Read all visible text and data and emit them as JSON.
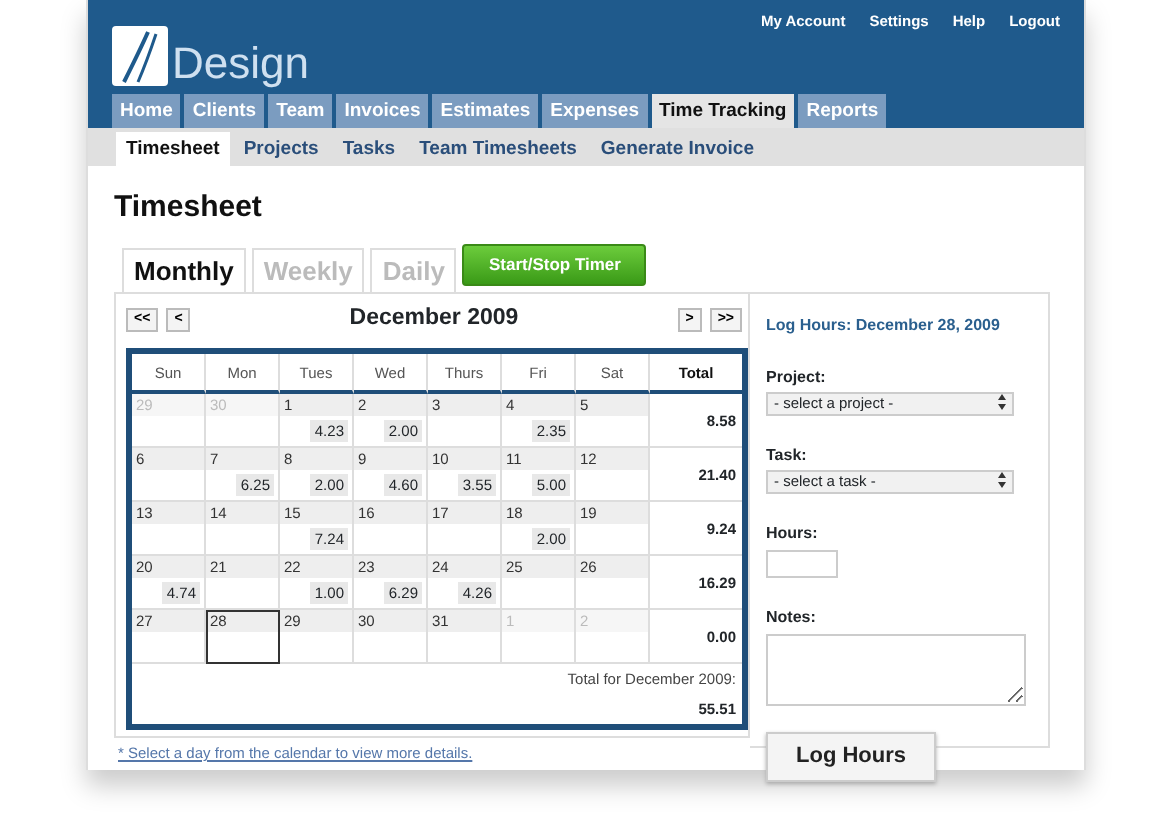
{
  "header": {
    "logo_text": "Design",
    "top_links": [
      "My Account",
      "Settings",
      "Help",
      "Logout"
    ]
  },
  "nav": [
    {
      "label": "Home",
      "selected": false
    },
    {
      "label": "Clients",
      "selected": false
    },
    {
      "label": "Team",
      "selected": false
    },
    {
      "label": "Invoices",
      "selected": false
    },
    {
      "label": "Estimates",
      "selected": false
    },
    {
      "label": "Expenses",
      "selected": false
    },
    {
      "label": "Time Tracking",
      "selected": true
    },
    {
      "label": "Reports",
      "selected": false
    }
  ],
  "subnav": [
    {
      "label": "Timesheet",
      "selected": true
    },
    {
      "label": "Projects",
      "selected": false
    },
    {
      "label": "Tasks",
      "selected": false
    },
    {
      "label": "Team Timesheets",
      "selected": false
    },
    {
      "label": "Generate Invoice",
      "selected": false
    }
  ],
  "page_title": "Timesheet",
  "view_tabs": [
    {
      "label": "Monthly",
      "selected": true
    },
    {
      "label": "Weekly",
      "selected": false
    },
    {
      "label": "Daily",
      "selected": false
    }
  ],
  "timer_button": "Start/Stop Timer",
  "calendar": {
    "prev_buttons": [
      "<<",
      "<"
    ],
    "month": "December 2009",
    "next_buttons": [
      ">",
      ">>"
    ],
    "weekdays": [
      "Sun",
      "Mon",
      "Tues",
      "Wed",
      "Thurs",
      "Fri",
      "Sat"
    ],
    "total_heading": "Total",
    "weeks": [
      {
        "days": [
          {
            "day": "29",
            "muted": true,
            "selected": false
          },
          {
            "day": "30",
            "muted": true,
            "selected": false
          },
          {
            "day": "1",
            "muted": false,
            "selected": false,
            "hours": "4.23"
          },
          {
            "day": "2",
            "muted": false,
            "selected": false,
            "hours": "2.00"
          },
          {
            "day": "3",
            "muted": false,
            "selected": false
          },
          {
            "day": "4",
            "muted": false,
            "selected": false,
            "hours": "2.35"
          },
          {
            "day": "5",
            "muted": false,
            "selected": false
          }
        ],
        "total": "8.58"
      },
      {
        "days": [
          {
            "day": "6",
            "muted": false,
            "selected": false
          },
          {
            "day": "7",
            "muted": false,
            "selected": false,
            "hours": "6.25"
          },
          {
            "day": "8",
            "muted": false,
            "selected": false,
            "hours": "2.00"
          },
          {
            "day": "9",
            "muted": false,
            "selected": false,
            "hours": "4.60"
          },
          {
            "day": "10",
            "muted": false,
            "selected": false,
            "hours": "3.55"
          },
          {
            "day": "11",
            "muted": false,
            "selected": false,
            "hours": "5.00"
          },
          {
            "day": "12",
            "muted": false,
            "selected": false
          }
        ],
        "total": "21.40"
      },
      {
        "days": [
          {
            "day": "13",
            "muted": false,
            "selected": false
          },
          {
            "day": "14",
            "muted": false,
            "selected": false
          },
          {
            "day": "15",
            "muted": false,
            "selected": false,
            "hours": "7.24"
          },
          {
            "day": "16",
            "muted": false,
            "selected": false
          },
          {
            "day": "17",
            "muted": false,
            "selected": false
          },
          {
            "day": "18",
            "muted": false,
            "selected": false,
            "hours": "2.00"
          },
          {
            "day": "19",
            "muted": false,
            "selected": false
          }
        ],
        "total": "9.24"
      },
      {
        "days": [
          {
            "day": "20",
            "muted": false,
            "selected": false,
            "hours": "4.74"
          },
          {
            "day": "21",
            "muted": false,
            "selected": false
          },
          {
            "day": "22",
            "muted": false,
            "selected": false,
            "hours": "1.00"
          },
          {
            "day": "23",
            "muted": false,
            "selected": false,
            "hours": "6.29"
          },
          {
            "day": "24",
            "muted": false,
            "selected": false,
            "hours": "4.26"
          },
          {
            "day": "25",
            "muted": false,
            "selected": false
          },
          {
            "day": "26",
            "muted": false,
            "selected": false
          }
        ],
        "total": "16.29"
      },
      {
        "days": [
          {
            "day": "27",
            "muted": false,
            "selected": false
          },
          {
            "day": "28",
            "muted": false,
            "selected": true
          },
          {
            "day": "29",
            "muted": false,
            "selected": false
          },
          {
            "day": "30",
            "muted": false,
            "selected": false
          },
          {
            "day": "31",
            "muted": false,
            "selected": false
          },
          {
            "day": "1",
            "muted": true,
            "selected": false
          },
          {
            "day": "2",
            "muted": true,
            "selected": false
          }
        ],
        "total": "0.00"
      }
    ],
    "grand_total_label": "Total for December 2009:",
    "grand_total": "55.51"
  },
  "footnote": "* Select a day from the calendar to view more details.",
  "log_form": {
    "heading": "Log Hours: December 28, 2009",
    "project_label": "Project:",
    "project_value": "- select a project -",
    "task_label": "Task:",
    "task_value": "- select a task -",
    "hours_label": "Hours:",
    "notes_label": "Notes:",
    "submit": "Log Hours"
  }
}
